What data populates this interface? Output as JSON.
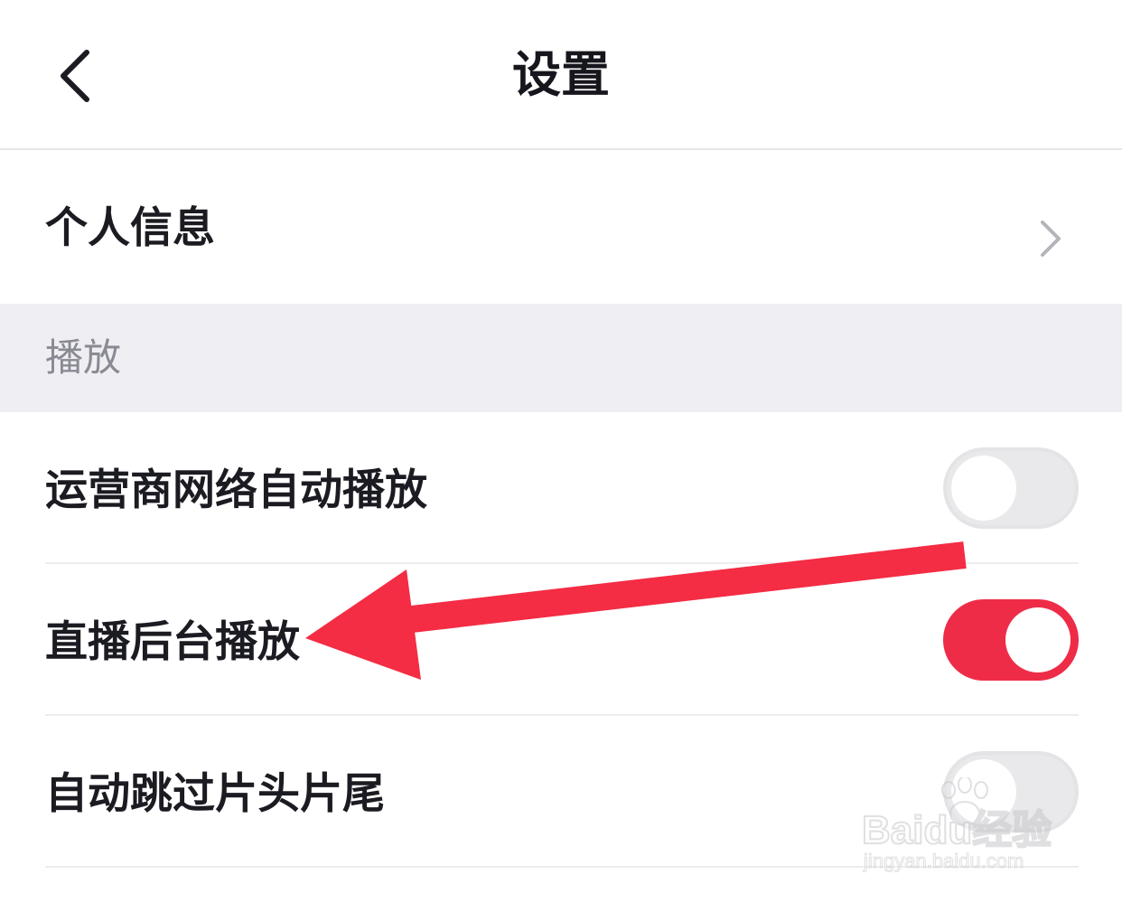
{
  "header": {
    "title": "设置",
    "back_icon": "chevron-left-icon"
  },
  "profile_row": {
    "label": "个人信息",
    "chevron_icon": "chevron-right-icon"
  },
  "section": {
    "label": "播放"
  },
  "settings": [
    {
      "label": "运营商网络自动播放",
      "enabled": false
    },
    {
      "label": "直播后台播放",
      "enabled": true
    },
    {
      "label": "自动跳过片头片尾",
      "enabled": false
    }
  ],
  "colors": {
    "toggle_on": "#ee2c48",
    "toggle_off": "#e9e9eb",
    "annotation_arrow": "#f42c44",
    "section_bg": "#efeff3"
  },
  "watermark": {
    "brand": "Baidu经验",
    "url": "jingyan.baidu.com"
  }
}
